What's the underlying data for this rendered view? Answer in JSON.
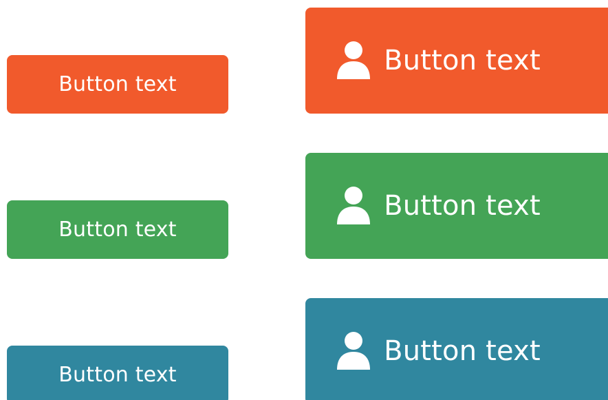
{
  "buttons": {
    "small": [
      {
        "label": "Button text",
        "color": "#f15a2c"
      },
      {
        "label": "Button text",
        "color": "#44a456"
      },
      {
        "label": "Button text",
        "color": "#30879f"
      }
    ],
    "large": [
      {
        "label": "Button text",
        "icon": "user-icon",
        "color": "#f15a2c"
      },
      {
        "label": "Button text",
        "icon": "user-icon",
        "color": "#44a456"
      },
      {
        "label": "Button text",
        "icon": "user-icon",
        "color": "#30879f"
      }
    ]
  }
}
